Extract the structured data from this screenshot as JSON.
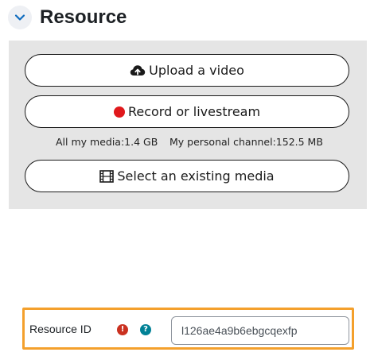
{
  "section": {
    "title": "Resource",
    "toggle_icon": "chevron-down-icon"
  },
  "media": {
    "upload_label": "Upload a video",
    "upload_icon": "cloud-upload-icon",
    "record_label": "Record or livestream",
    "record_icon": "red-record-dot-icon",
    "all_media_usage": "All my media:1.4 GB",
    "personal_channel_usage": "My personal channel:152.5 MB",
    "select_label": "Select an existing media",
    "select_icon": "film-icon"
  },
  "resource_field": {
    "label": "Resource ID",
    "required_icon": "exclamation-icon",
    "help_icon": "question-icon",
    "value": "l126ae4a9b6ebgcqexfp"
  },
  "colors": {
    "highlight_border": "#f4a02c",
    "required": "#ca3120",
    "help": "#008196",
    "record": "#e0191c",
    "panel_bg": "#e5e5e5",
    "chevron": "#0f6cbf"
  }
}
